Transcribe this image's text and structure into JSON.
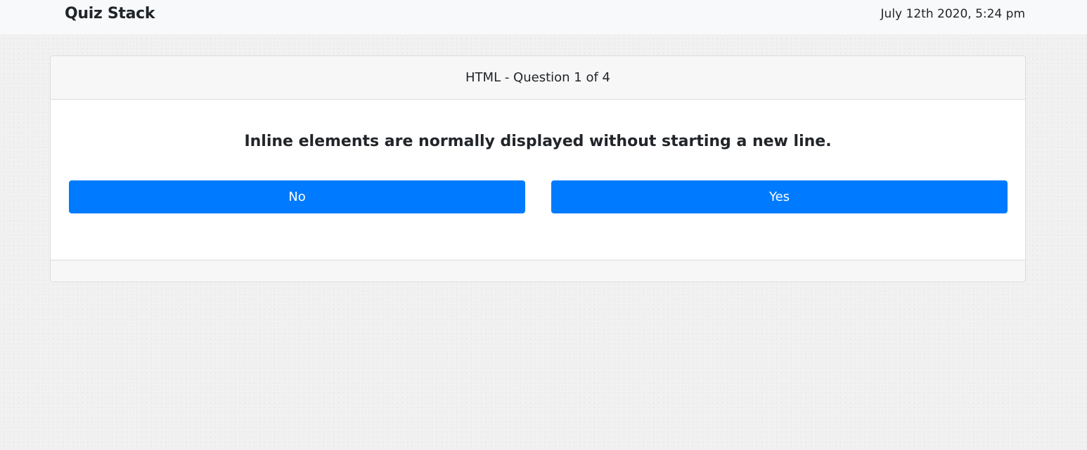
{
  "navbar": {
    "brand": "Quiz Stack",
    "datetime": "July 12th 2020, 5:24 pm"
  },
  "quiz": {
    "header": "HTML - Question 1 of 4",
    "question": "Inline elements are normally displayed without starting a new line.",
    "answers": {
      "no_label": "No",
      "yes_label": "Yes"
    }
  },
  "colors": {
    "accent": "#007bff",
    "navbar_bg": "#f8f9fa",
    "card_header_bg": "#f7f7f7"
  }
}
